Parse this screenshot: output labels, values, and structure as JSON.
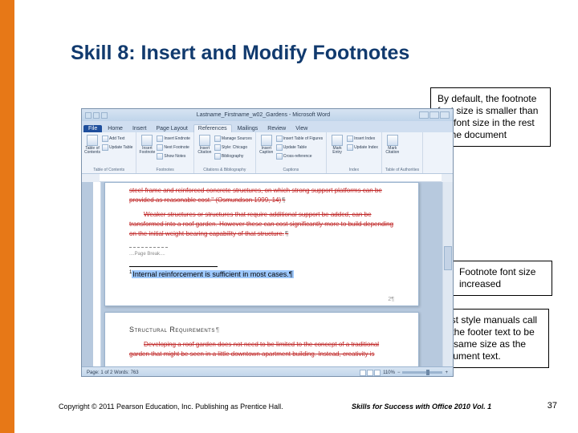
{
  "slide": {
    "title": "Skill 8: Insert and Modify Footnotes",
    "callout1": "By default, the footnote font size is smaller\nthan the font size in the rest of the document",
    "callout2": "Footnote font size increased",
    "callout3": "Most style manuals call for the footer text to be the same size as the document text.",
    "footer_left": "Copyright © 2011 Pearson Education, Inc. Publishing as Prentice Hall.",
    "footer_center": "Skills for Success with Office 2010 Vol. 1",
    "footer_right": "37"
  },
  "word": {
    "titlebar": "Lastname_Firstname_w02_Gardens - Microsoft Word",
    "tabs": {
      "file": "File",
      "t1": "Home",
      "t2": "Insert",
      "t3": "Page Layout",
      "t4": "References",
      "t5": "Mailings",
      "t6": "Review",
      "t7": "View"
    },
    "ribbon": {
      "g1_label": "Table of Contents",
      "g1_btn1": "Table of\nContents",
      "g1_btn2": "Add Text",
      "g1_btn3": "Update Table",
      "g2_label": "Footnotes",
      "g2_btn1": "Insert\nFootnote",
      "g2_btn2": "Insert Endnote",
      "g2_btn3": "Next Footnote",
      "g2_btn4": "Show Notes",
      "g3_label": "Citations & Bibliography",
      "g3_btn1": "Insert\nCitation",
      "g3_btn2": "Manage Sources",
      "g3_btn3": "Style: Chicago",
      "g3_btn4": "Bibliography",
      "g4_label": "Captions",
      "g4_btn1": "Insert\nCaption",
      "g4_btn2": "Insert Table of Figures",
      "g4_btn3": "Update Table",
      "g4_btn4": "Cross-reference",
      "g5_label": "Index",
      "g5_btn1": "Mark\nEntry",
      "g5_btn2": "Insert Index",
      "g5_btn3": "Update Index",
      "g6_label": "Table of Authorities",
      "g6_btn1": "Mark\nCitation"
    },
    "doc": {
      "p1_l1": "steel-frame and reinforced-concrete structures, on which strong support platforms can be",
      "p1_l2": "provided as reasonable cost.\" (Osmundson 1999, 14)",
      "p2_l1": "Weaker structures or structures that require additional support be added, can be",
      "p2_l2": "transformed into a roof garden. However these can cost significantly more to build depending",
      "p2_l3": "on the initial weight-bearing capability of that structure.",
      "pagebreak": "Page Break",
      "footnote_text": "Internal reinforcement is sufficient in most cases.",
      "page_num": "2",
      "p2_title": "Structural Requirements",
      "p2_body1": "Developing a roof garden does not need to be limited to the concept of a traditional",
      "p2_body2": "garden that might be seen in a little downtown apartment building. Instead, creativity is"
    },
    "status": {
      "left": "Page: 1 of 2    Words: 763",
      "zoom": "110%"
    }
  }
}
